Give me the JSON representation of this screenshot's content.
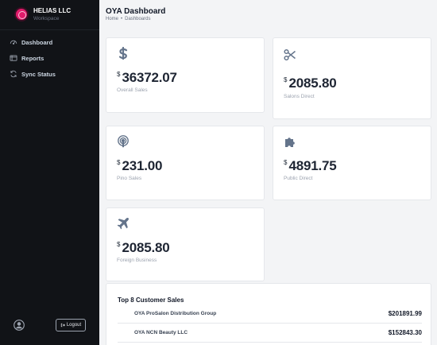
{
  "brand": {
    "name": "HELIAS LLC",
    "subtitle": "Workspace"
  },
  "sidebar": {
    "items": [
      {
        "label": "Dashboard",
        "icon": "dashboard-icon"
      },
      {
        "label": "Reports",
        "icon": "reports-icon"
      },
      {
        "label": "Sync Status",
        "icon": "sync-icon"
      }
    ],
    "logout_label": "Logout"
  },
  "header": {
    "title": "OYA Dashboard",
    "breadcrumb": [
      "Home",
      "•",
      "Dashboards"
    ]
  },
  "cards": [
    {
      "icon": "dollar-icon",
      "currency": "$",
      "value": "36372.07",
      "label": "Overall Sales"
    },
    {
      "icon": "scissors-icon",
      "currency": "$",
      "value": "2085.80",
      "label": "Salons Direct"
    },
    {
      "icon": "podcast-icon",
      "currency": "$",
      "value": "231.00",
      "label": "Pino Sales"
    },
    {
      "icon": "puzzle-icon",
      "currency": "$",
      "value": "4891.75",
      "label": "Public Direct"
    },
    {
      "icon": "plane-icon",
      "currency": "$",
      "value": "2085.80",
      "label": "Foreign Business"
    }
  ],
  "customers": {
    "title": "Top 8 Customer Sales",
    "rows": [
      {
        "name": "OYA ProSalon Distribution Group",
        "amount": "$201891.99"
      },
      {
        "name": "OYA NCN Beauty LLC",
        "amount": "$152843.30"
      }
    ]
  },
  "colors": {
    "sidebar_bg": "#111317",
    "accent": "#e21b6b",
    "icon": "#64748b",
    "page_bg": "#f3f4f6"
  }
}
